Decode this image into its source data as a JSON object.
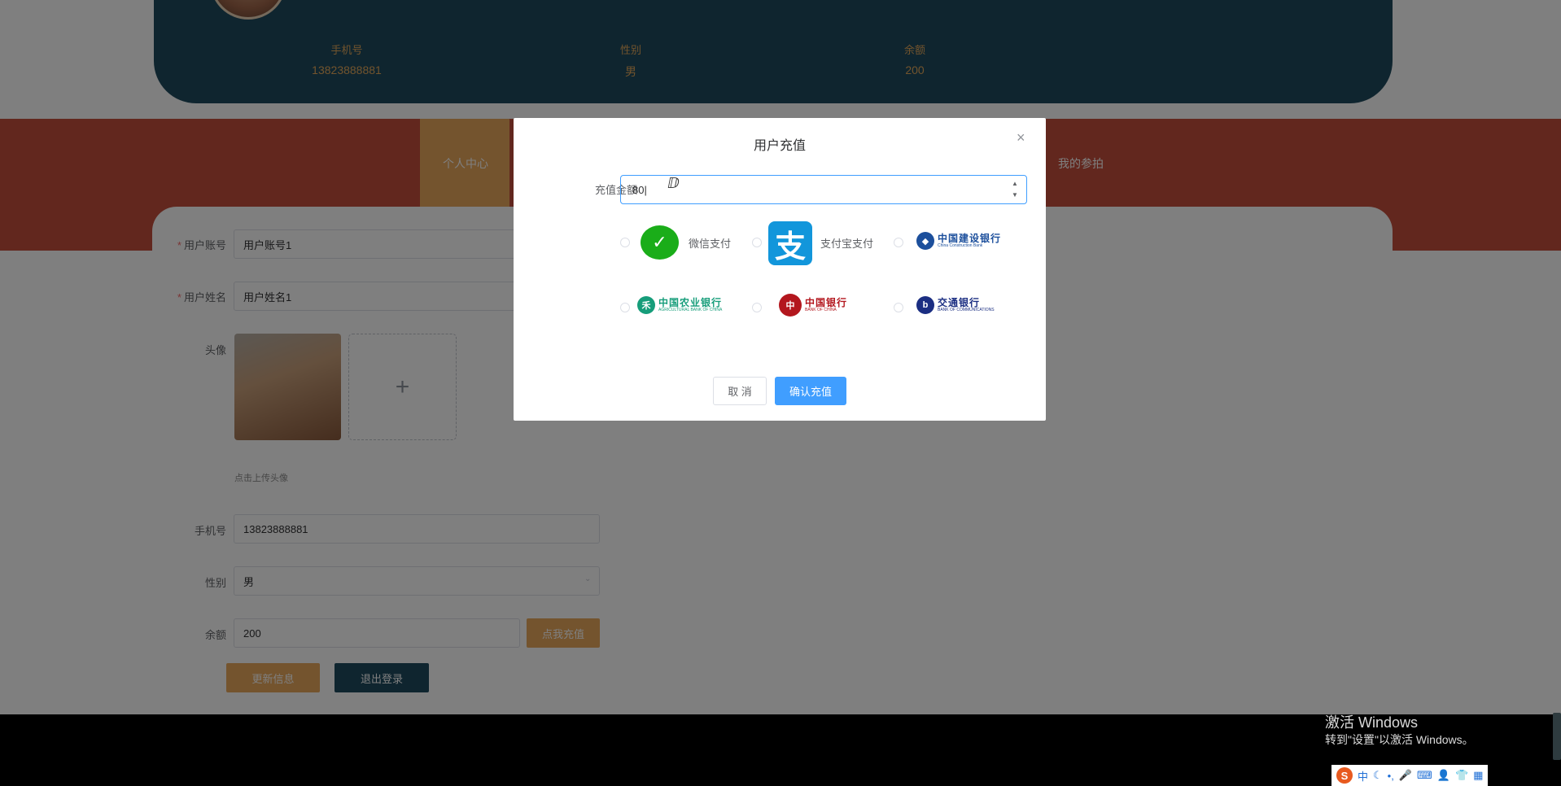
{
  "profile": {
    "phone_label": "手机号",
    "phone_value": "13823888881",
    "gender_label": "性别",
    "gender_value": "男",
    "balance_label": "余额",
    "balance_value": "200"
  },
  "nav": {
    "active_label": "个人中心",
    "bids_label": "我的参拍"
  },
  "form": {
    "account_label": "用户账号",
    "account_value": "用户账号1",
    "name_label": "用户姓名",
    "name_value": "用户姓名1",
    "avatar_label": "头像",
    "upload_plus": "+",
    "upload_hint": "点击上传头像",
    "phone_label": "手机号",
    "phone_value": "13823888881",
    "gender_label": "性别",
    "gender_value": "男",
    "balance_label": "余额",
    "balance_value": "200",
    "recharge_button": "点我充值",
    "update_button": "更新信息",
    "logout_button": "退出登录"
  },
  "dialog": {
    "title": "用户充值",
    "close": "×",
    "amount_label": "充值金额",
    "amount_value": "80",
    "payment_options": {
      "wechat": "微信支付",
      "alipay": "支付宝支付",
      "ccb": "中国建设银行",
      "ccb_en": "China Construction Bank",
      "abc": "中国农业银行",
      "abc_en": "AGRICULTURAL BANK OF CHINA",
      "boc": "中国银行",
      "boc_en": "BANK OF CHINA",
      "bocom": "交通银行",
      "bocom_en": "BANK OF COMMUNICATIONS"
    },
    "cancel_button": "取 消",
    "confirm_button": "确认充值"
  },
  "windows_watermark": {
    "line1": "激活 Windows",
    "line2": "转到\"设置\"以激活 Windows。"
  },
  "tray": {
    "ime_logo": "S",
    "ime_mode": "中"
  },
  "colors": {
    "banner": "#1e4a5e",
    "nav_band": "#c44f3c",
    "accent_orange": "#e9a85c",
    "primary_blue": "#409eff"
  }
}
